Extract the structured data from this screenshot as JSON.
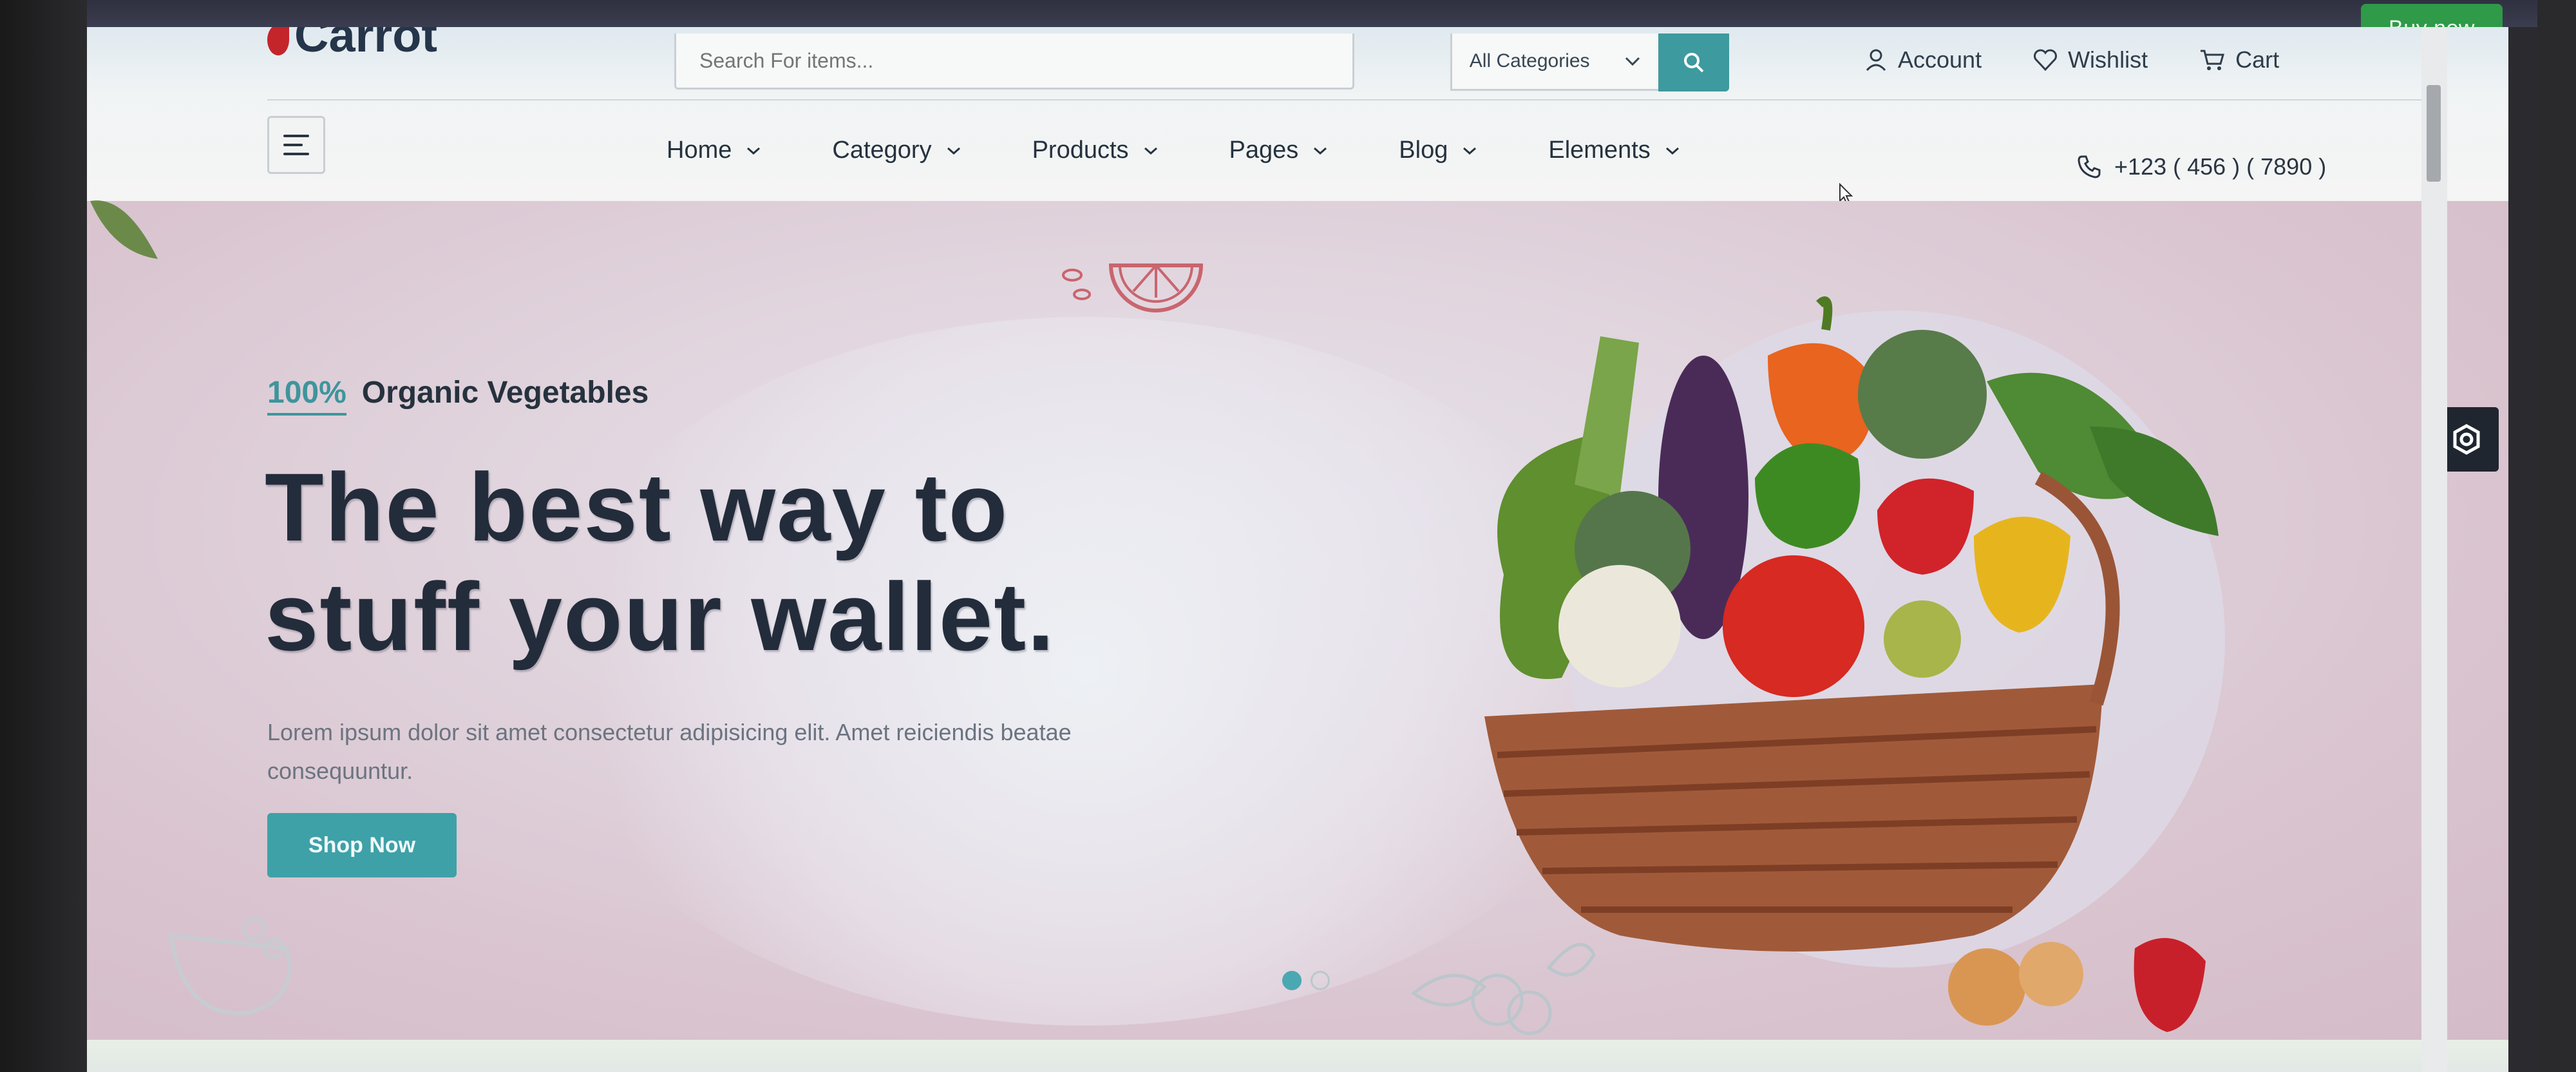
{
  "promo": {
    "buy_now_label": "Buy now"
  },
  "header": {
    "logo_text": "Carrot",
    "search": {
      "placeholder": "Search For items..."
    },
    "category_select": {
      "value": "All Categories"
    },
    "top_links": [
      {
        "label": "Account",
        "icon": "user-icon"
      },
      {
        "label": "Wishlist",
        "icon": "heart-icon"
      },
      {
        "label": "Cart",
        "icon": "cart-icon"
      }
    ],
    "nav": [
      {
        "label": "Home"
      },
      {
        "label": "Category"
      },
      {
        "label": "Products"
      },
      {
        "label": "Pages"
      },
      {
        "label": "Blog"
      },
      {
        "label": "Elements"
      }
    ],
    "phone": "+123 ( 456 ) ( 7890 )"
  },
  "hero": {
    "tagline_accent": "100%",
    "tagline_rest": "Organic Vegetables",
    "headline_line1": "The best way to",
    "headline_line2": "stuff your wallet.",
    "description": "Lorem ipsum dolor sit amet consectetur adipisicing elit. Amet reiciendis beatae consequuntur.",
    "cta_label": "Shop Now",
    "slider": {
      "total": 2,
      "active": 1
    }
  },
  "colors": {
    "accent": "#3ea1a8",
    "buy_now": "#2f9a48",
    "headline": "#232c3a",
    "logo_mark": "#c4252b"
  }
}
